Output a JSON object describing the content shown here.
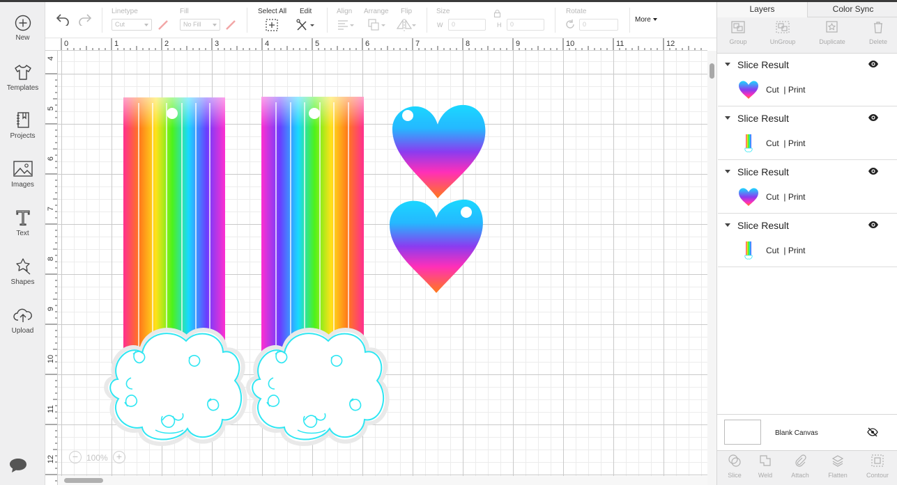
{
  "sidebar": {
    "items": [
      {
        "label": "New",
        "icon": "plus-circle-icon"
      },
      {
        "label": "Templates",
        "icon": "tshirt-icon"
      },
      {
        "label": "Projects",
        "icon": "notebook-icon"
      },
      {
        "label": "Images",
        "icon": "image-icon"
      },
      {
        "label": "Text",
        "icon": "text-icon"
      },
      {
        "label": "Shapes",
        "icon": "shapes-icon"
      },
      {
        "label": "Upload",
        "icon": "cloud-upload-icon"
      }
    ],
    "chat_icon": "chat-bubble-icon"
  },
  "toolbar": {
    "linetype_label": "Linetype",
    "linetype_value": "Cut",
    "fill_label": "Fill",
    "fill_value": "No Fill",
    "select_all_label": "Select All",
    "edit_label": "Edit",
    "align_label": "Align",
    "arrange_label": "Arrange",
    "flip_label": "Flip",
    "size_label": "Size",
    "width_label": "W",
    "width_value": "0",
    "height_label": "H",
    "height_value": "0",
    "rotate_label": "Rotate",
    "rotate_value": "0",
    "more_label": "More"
  },
  "ruler": {
    "top": [
      "0",
      "1",
      "2",
      "3",
      "4",
      "5",
      "6",
      "7",
      "8",
      "9",
      "10",
      "11",
      "12"
    ],
    "left": [
      "4",
      "5",
      "6",
      "7",
      "8",
      "9",
      "10",
      "11",
      "12"
    ]
  },
  "canvas": {
    "zoom": "100%"
  },
  "panel": {
    "tabs": [
      {
        "label": "Layers",
        "active": true
      },
      {
        "label": "Color Sync",
        "active": false
      }
    ],
    "tools": [
      "Group",
      "UnGroup",
      "Duplicate",
      "Delete"
    ],
    "layers": [
      {
        "title": "Slice Result",
        "thumb": "heart",
        "op_cut": "Cut",
        "op_print": "Print"
      },
      {
        "title": "Slice Result",
        "thumb": "rainbow",
        "op_cut": "Cut",
        "op_print": "Print"
      },
      {
        "title": "Slice Result",
        "thumb": "heart",
        "op_cut": "Cut",
        "op_print": "Print"
      },
      {
        "title": "Slice Result",
        "thumb": "rainbow",
        "op_cut": "Cut",
        "op_print": "Print"
      }
    ],
    "blank_canvas_label": "Blank Canvas",
    "bottom_tools": [
      "Slice",
      "Weld",
      "Attach",
      "Flatten",
      "Contour"
    ]
  },
  "colors": {
    "sidebar_bg": "#efeff0",
    "outline_cyan": "#2ee6f2",
    "heart_top": "#1ad8ff",
    "heart_mid": "#8a3cf0",
    "heart_bottom": "#ff7a1a"
  }
}
